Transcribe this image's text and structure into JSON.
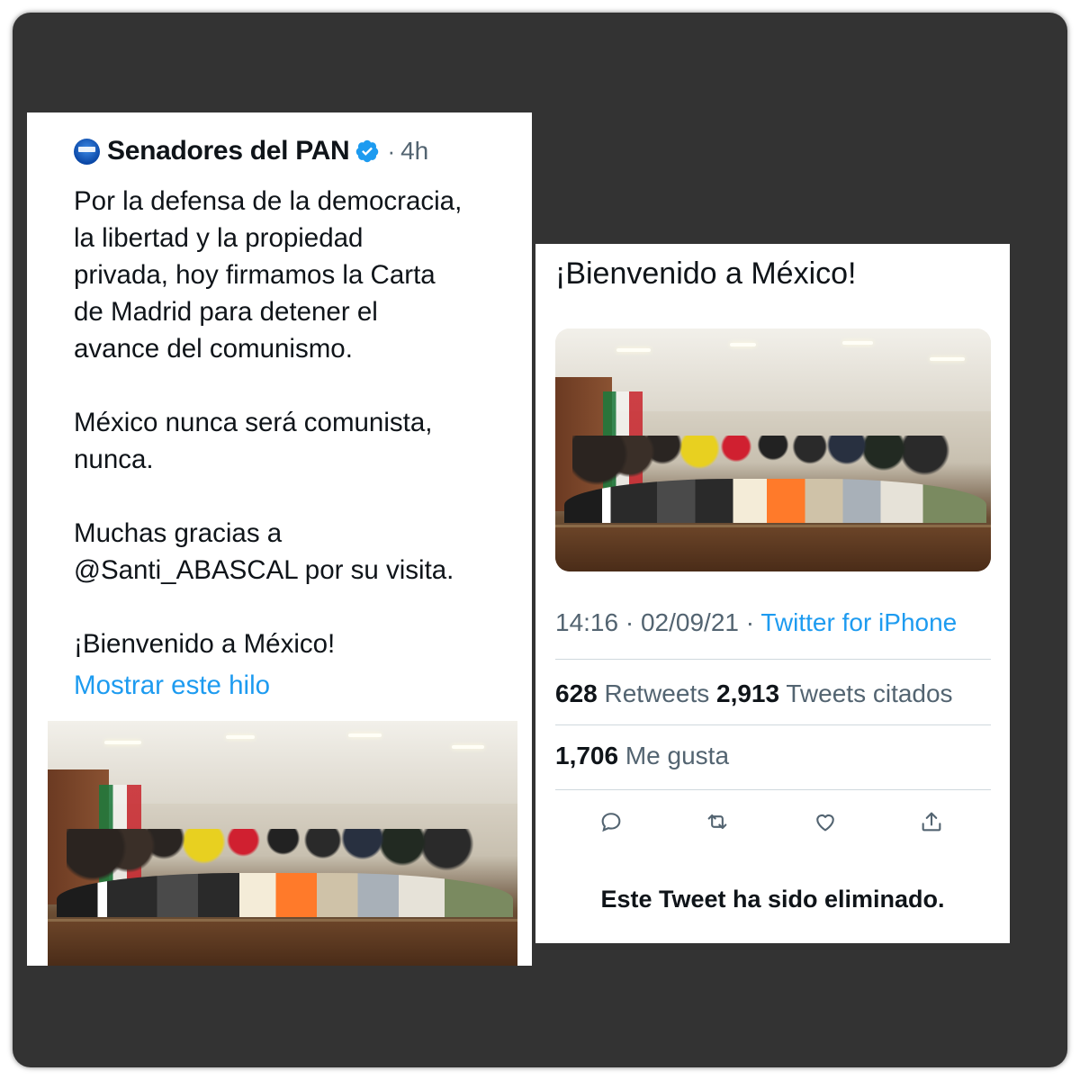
{
  "left_tweet": {
    "account_name": "Senadores del PAN",
    "separator": "·",
    "time": "4h",
    "paragraphs": [
      "Por la defensa de la democracia,\nla libertad y la propiedad\nprivada, hoy firmamos la Carta\nde Madrid para detener el\navance del comunismo.",
      "México nunca será comunista,\nnunca.",
      "Muchas gracias a\n@Santi_ABASCAL por su visita.",
      "¡Bienvenido a México!"
    ],
    "thread_link": "Mostrar este hilo",
    "avatar_icon": "senate-logo-icon",
    "verified_icon": "verified-badge-icon"
  },
  "right_tweet": {
    "text": "¡Bienvenido a México!",
    "time": "14:16",
    "separator": "·",
    "date": "02/09/21",
    "source": "Twitter for iPhone",
    "retweets_count": "628",
    "retweets_label": "Retweets",
    "quotes_count": "2,913",
    "quotes_label": "Tweets citados",
    "likes_count": "1,706",
    "likes_label": "Me gusta",
    "action_icons": [
      "reply-icon",
      "retweet-icon",
      "like-icon",
      "share-icon"
    ],
    "deleted_notice": "Este Tweet ha sido eliminado."
  },
  "colors": {
    "accent": "#1d9bf0",
    "text_primary": "#0f1419",
    "text_secondary": "#536471",
    "frame": "#333333"
  }
}
